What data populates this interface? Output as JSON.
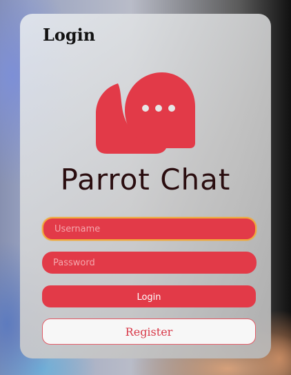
{
  "page": {
    "title": "Login"
  },
  "logo": {
    "text": "Parrot Chat",
    "icon": "chat-bubbles-icon"
  },
  "form": {
    "username_placeholder": "Username",
    "password_placeholder": "Password",
    "login_label": "Login",
    "register_label": "Register"
  },
  "colors": {
    "accent": "#e23a48",
    "logo_text": "#2a0d0f",
    "focus_ring": "#f0a93a"
  }
}
